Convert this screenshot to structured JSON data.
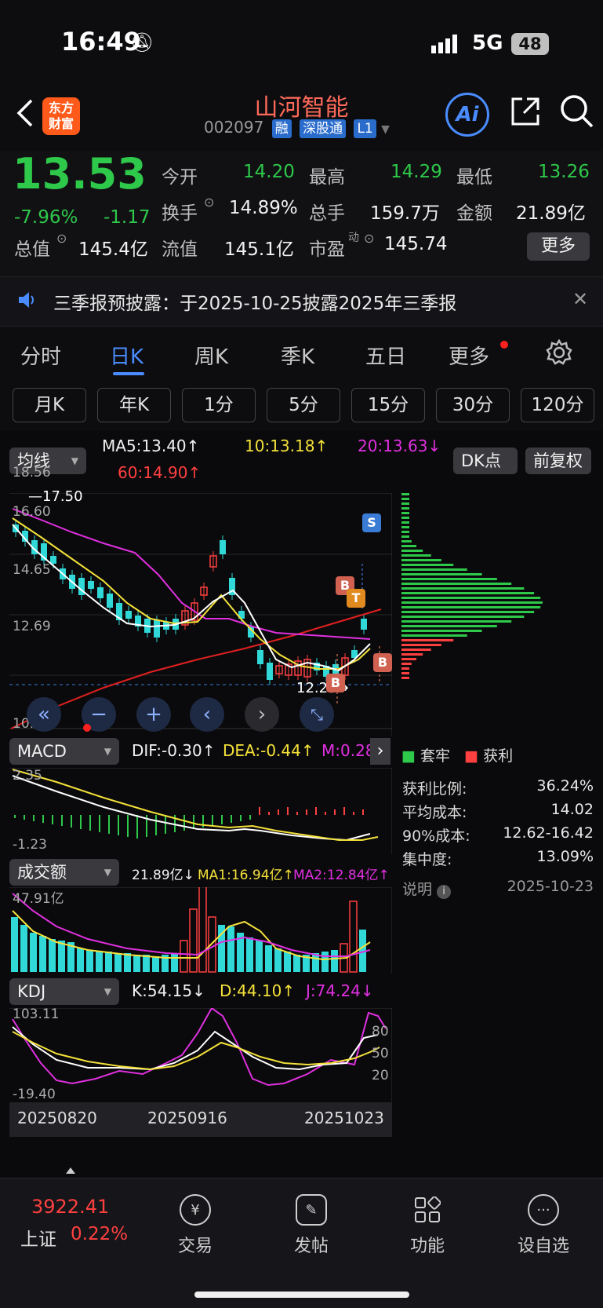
{
  "status": {
    "time": "16:49",
    "network": "5G",
    "battery": "48"
  },
  "header": {
    "logo": "东方\n财富",
    "title": "山河智能",
    "code": "002097",
    "tags": [
      "融",
      "深股通",
      "L1"
    ],
    "ai_label": "Ai"
  },
  "quote": {
    "price": "13.53",
    "change_pct": "-7.96%",
    "change": "-1.17",
    "open_label": "今开",
    "open": "14.20",
    "high_label": "最高",
    "high": "14.29",
    "low_label": "最低",
    "low": "13.26",
    "turnover_label": "换手",
    "turnover": "14.89%",
    "volume_label": "总手",
    "volume": "159.7万",
    "amount_label": "金额",
    "amount": "21.89亿",
    "mktcap_label": "总值",
    "mktcap": "145.4亿",
    "float_label": "流值",
    "float": "145.1亿",
    "pe_label": "市盈",
    "pe_sup": "动",
    "pe": "145.74",
    "more_button": "更多"
  },
  "notice": {
    "text": "三季报预披露：于2025-10-25披露2025年三季报"
  },
  "tabs": [
    "分时",
    "日K",
    "周K",
    "季K",
    "五日",
    "更多"
  ],
  "active_tab": "日K",
  "subtabs": [
    "月K",
    "年K",
    "1分",
    "5分",
    "15分",
    "30分",
    "120分"
  ],
  "ma_bar": {
    "selector": "均线",
    "ma5": "MA5:13.40↑",
    "ma10": "10:13.18↑",
    "ma20": "20:13.63↓",
    "ma60": "60:14.90↑",
    "dk_button": "DK点",
    "adjust_button": "前复权"
  },
  "kline": {
    "price_ticks": [
      "18.56",
      "16.60",
      "14.65",
      "12.69",
      "10.73"
    ],
    "max_label": "17.50",
    "min_label": "12.25",
    "badges": {
      "s": "S",
      "b": "B",
      "t": "T"
    }
  },
  "macd": {
    "selector": "MACD",
    "dif": "DIF:-0.30↑",
    "dea": "DEA:-0.44↑",
    "m": "M:0.28",
    "top": "2.35",
    "bottom": "-1.23"
  },
  "volume_panel": {
    "selector": "成交额",
    "value": "21.89亿↓",
    "ma1": "MA1:16.94亿↑",
    "ma2": "MA2:12.84亿↑",
    "top": "47.91亿"
  },
  "kdj": {
    "selector": "KDJ",
    "k": "K:54.15↓",
    "d": "D:44.10↑",
    "j": "J:74.24↓",
    "top": "103.11",
    "bottom": "-19.40",
    "levels": [
      "80",
      "50",
      "20"
    ]
  },
  "dates": [
    "20250820",
    "20250916",
    "20251023"
  ],
  "chip": {
    "legend_trapped": "套牢",
    "legend_profit": "获利",
    "rows": [
      {
        "label": "获利比例:",
        "value": "36.24%"
      },
      {
        "label": "平均成本:",
        "value": "14.02"
      },
      {
        "label": "90%成本:",
        "value": "12.62-16.42"
      },
      {
        "label": "集中度:",
        "value": "13.09%"
      }
    ],
    "explain": "说明",
    "date": "2025-10-23"
  },
  "bottom_nav": {
    "index_value": "3922.41",
    "index_name": "上证",
    "index_pct": "0.22%",
    "items": [
      {
        "label": "交易",
        "icon": "yen-icon"
      },
      {
        "label": "发帖",
        "icon": "edit-icon"
      },
      {
        "label": "功能",
        "icon": "grid-icon"
      },
      {
        "label": "设自选",
        "icon": "more-icon"
      }
    ]
  },
  "colors": {
    "up": "#ff4040",
    "down": "#2ec84a",
    "ma5": "#ffffff",
    "ma10": "#f4e13a",
    "ma20": "#e030e0",
    "ma60": "#e02020",
    "bear_candle": "#31d8d8"
  }
}
